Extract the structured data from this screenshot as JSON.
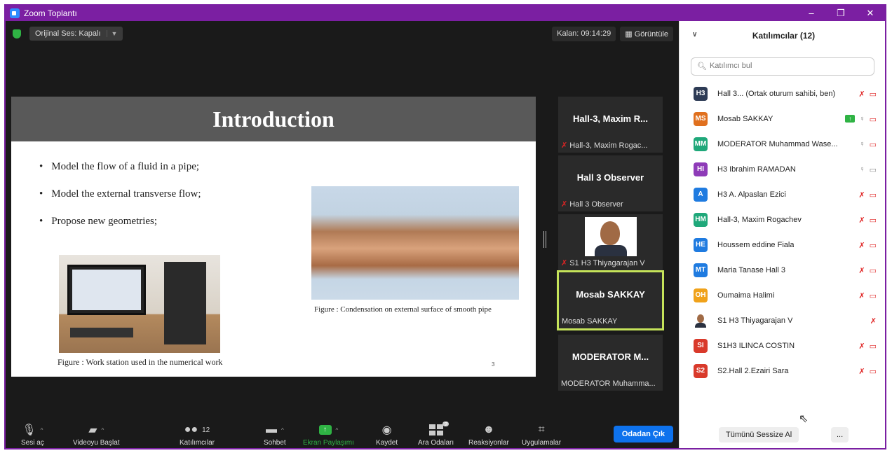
{
  "window": {
    "title": "Zoom Toplantı",
    "controls": [
      "–",
      "❐",
      "✕"
    ]
  },
  "topbar": {
    "original_sound": "Orijinal Ses: Kapalı",
    "remaining": "Kalan: 09:14:29",
    "view": "Görüntüle"
  },
  "slide": {
    "title": "Introduction",
    "bullets": [
      "Model the flow of a fluid in a pipe;",
      "Model the external transverse flow;",
      "Propose new geometries;"
    ],
    "caption_workstation": "Figure : Work station used in the numerical work",
    "caption_pipe": "Figure : Condensation on external surface of smooth pipe",
    "page": "3"
  },
  "thumbs": [
    {
      "big": "Hall-3,  Maxim  R...",
      "small": "Hall-3, Maxim Rogac...",
      "muted": true
    },
    {
      "big": "Hall 3  Observer",
      "small": "Hall 3  Observer",
      "muted": true
    },
    {
      "big": "",
      "small": "S1 H3 Thiyagarajan V",
      "muted": true
    },
    {
      "big": "Mosab SAKKAY",
      "small": "Mosab SAKKAY",
      "muted": false
    },
    {
      "big": "MODERATOR  M...",
      "small": "MODERATOR Muhamma...",
      "muted": false
    }
  ],
  "toolbar": {
    "audio": "Sesi aç",
    "video": "Videoyu Başlat",
    "participants": "Katılımcılar",
    "participants_count": "12",
    "chat": "Sohbet",
    "share": "Ekran Paylaşımı",
    "record": "Kaydet",
    "breakout": "Ara Odaları",
    "breakout_badge": "2",
    "reactions": "Reaksiyonlar",
    "apps": "Uygulamalar",
    "leave": "Odadan Çık"
  },
  "panel": {
    "title": "Katılımcılar (12)",
    "search_placeholder": "Katılımcı bul",
    "participants": [
      {
        "initials": "H3",
        "name": "Hall 3... (Ortak oturum sahibi, ben)",
        "color": "#2d3b55"
      },
      {
        "initials": "MS",
        "name": "Mosab SAKKAY",
        "color": "#e0701e"
      },
      {
        "initials": "MM",
        "name": "MODERATOR Muhammad Wase...",
        "color": "#1fa87a"
      },
      {
        "initials": "HI",
        "name": "H3 Ibrahim RAMADAN",
        "color": "#8e3bb8"
      },
      {
        "initials": "A",
        "name": "H3 A. Alpaslan Ezici",
        "color": "#1f7be0"
      },
      {
        "initials": "HM",
        "name": "Hall-3, Maxim Rogachev",
        "color": "#1fa87a"
      },
      {
        "initials": "HE",
        "name": "Houssem eddine Fiala",
        "color": "#1f7be0"
      },
      {
        "initials": "MT",
        "name": "Maria Tanase Hall 3",
        "color": "#1f7be0"
      },
      {
        "initials": "OH",
        "name": "Oumaima Halimi",
        "color": "#f0a21a"
      },
      {
        "initials": "",
        "name": "S1 H3 Thiyagarajan V",
        "color": "#ffffff"
      },
      {
        "initials": "SI",
        "name": "S1H3 ILINCA COSTIN",
        "color": "#d93a2b"
      },
      {
        "initials": "S2",
        "name": "S2.Hall 2.Ezairi Sara",
        "color": "#d93a2b"
      }
    ],
    "mute_all": "Tümünü Sessize Al",
    "more": "..."
  }
}
